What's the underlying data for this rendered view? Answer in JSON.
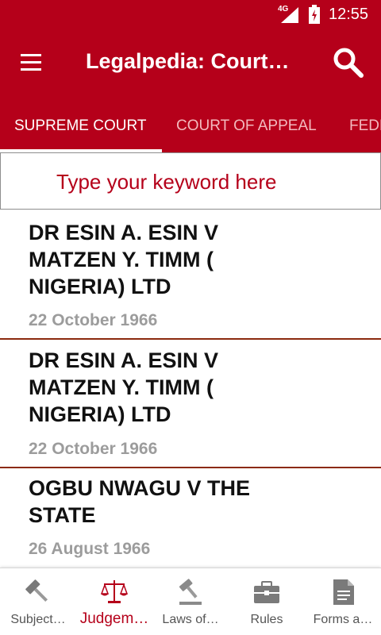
{
  "status_bar": {
    "network": "4G",
    "time": "12:55"
  },
  "app_bar": {
    "title": "Legalpedia: Court…"
  },
  "tabs": [
    {
      "label": "SUPREME COURT",
      "active": true
    },
    {
      "label": "COURT OF APPEAL",
      "active": false
    },
    {
      "label": "FEDE",
      "active": false
    }
  ],
  "search": {
    "placeholder": "Type your keyword here"
  },
  "cases": [
    {
      "title": "DR ESIN A. ESIN V MATZEN Y. TIMM ( NIGERIA) LTD",
      "date": "22 October 1966"
    },
    {
      "title": "DR ESIN A. ESIN V MATZEN Y. TIMM ( NIGERIA) LTD",
      "date": "22 October 1966"
    },
    {
      "title": "OGBU NWAGU V THE STATE",
      "date": "26 August 1966"
    }
  ],
  "bottom_nav": [
    {
      "label": "Subject…",
      "icon": "gavel-icon",
      "active": false
    },
    {
      "label": "Judgem…",
      "icon": "scales-icon",
      "active": true
    },
    {
      "label": "Laws of…",
      "icon": "gavel-icon",
      "active": false
    },
    {
      "label": "Rules",
      "icon": "briefcase-icon",
      "active": false
    },
    {
      "label": "Forms a…",
      "icon": "document-icon",
      "active": false
    }
  ],
  "colors": {
    "primary": "#b5001a",
    "divider": "#8b2a0e",
    "date_text": "#9c9c9c",
    "inactive_tab": "#f3b9bd"
  }
}
